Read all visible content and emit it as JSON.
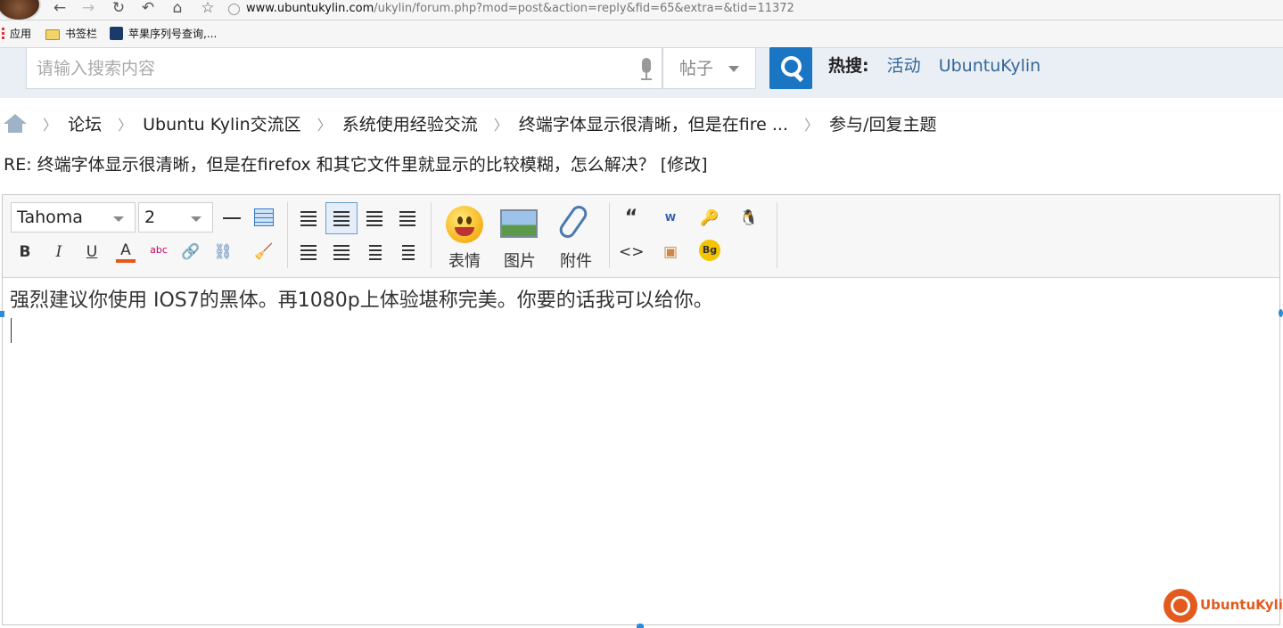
{
  "browser": {
    "url_host": "www.ubuntukylin.com",
    "url_path": "/ukylin/forum.php?mod=post&action=reply&fid=65&extra=&tid=11372",
    "bookmarks": [
      {
        "label": "应用",
        "icon": "apps-icon"
      },
      {
        "label": "书签栏",
        "icon": "folder-icon"
      },
      {
        "label": "苹果序列号查询,...",
        "icon": "apple-icon"
      }
    ]
  },
  "search": {
    "placeholder": "请输入搜索内容",
    "type_label": "帖子",
    "hot_label": "热搜:",
    "hot_links": [
      "活动",
      "UbuntuKylin"
    ]
  },
  "breadcrumb": [
    "论坛",
    "Ubuntu Kylin交流区",
    "系统使用经验交流",
    "终端字体显示很清晰，但是在fire ...",
    "参与/回复主题"
  ],
  "subject": {
    "text": "RE: 终端字体显示很清晰，但是在firefox 和其它文件里就显示的比较模糊，怎么解决？",
    "edit_link": "[修改]"
  },
  "editor": {
    "font_family": "Tahoma",
    "font_size": "2",
    "emoji_label": "表情",
    "image_label": "图片",
    "attach_label": "附件",
    "content": "强烈建议你使用 IOS7的黑体。再1080p上体验堪称完美。你要的话我可以给你。"
  },
  "logo": {
    "text": "UbuntuKylin",
    "color": "#e35a1e"
  },
  "colors": {
    "accent": "#1a76c2",
    "link": "#336699"
  }
}
